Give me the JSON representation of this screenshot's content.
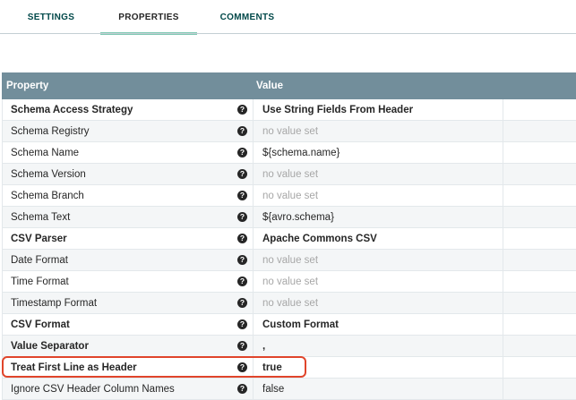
{
  "tabs": [
    {
      "label": "SETTINGS",
      "active": false
    },
    {
      "label": "PROPERTIES",
      "active": true
    },
    {
      "label": "COMMENTS",
      "active": false
    }
  ],
  "table": {
    "headers": {
      "property": "Property",
      "value": "Value"
    },
    "rows": [
      {
        "property": "Schema Access Strategy",
        "value": "Use String Fields From Header",
        "required": true,
        "empty": false
      },
      {
        "property": "Schema Registry",
        "value": "no value set",
        "required": false,
        "empty": true
      },
      {
        "property": "Schema Name",
        "value": "${schema.name}",
        "required": false,
        "empty": false
      },
      {
        "property": "Schema Version",
        "value": "no value set",
        "required": false,
        "empty": true
      },
      {
        "property": "Schema Branch",
        "value": "no value set",
        "required": false,
        "empty": true
      },
      {
        "property": "Schema Text",
        "value": "${avro.schema}",
        "required": false,
        "empty": false
      },
      {
        "property": "CSV Parser",
        "value": "Apache Commons CSV",
        "required": true,
        "empty": false
      },
      {
        "property": "Date Format",
        "value": "no value set",
        "required": false,
        "empty": true
      },
      {
        "property": "Time Format",
        "value": "no value set",
        "required": false,
        "empty": true
      },
      {
        "property": "Timestamp Format",
        "value": "no value set",
        "required": false,
        "empty": true
      },
      {
        "property": "CSV Format",
        "value": "Custom Format",
        "required": true,
        "empty": false
      },
      {
        "property": "Value Separator",
        "value": ",",
        "required": true,
        "empty": false
      },
      {
        "property": "Treat First Line as Header",
        "value": "true",
        "required": true,
        "empty": false
      },
      {
        "property": "Ignore CSV Header Column Names",
        "value": "false",
        "required": false,
        "empty": false
      }
    ]
  },
  "colors": {
    "header_bg": "#728e9b",
    "tab_underline": "#7fc8b4",
    "highlight": "#e0452b"
  }
}
